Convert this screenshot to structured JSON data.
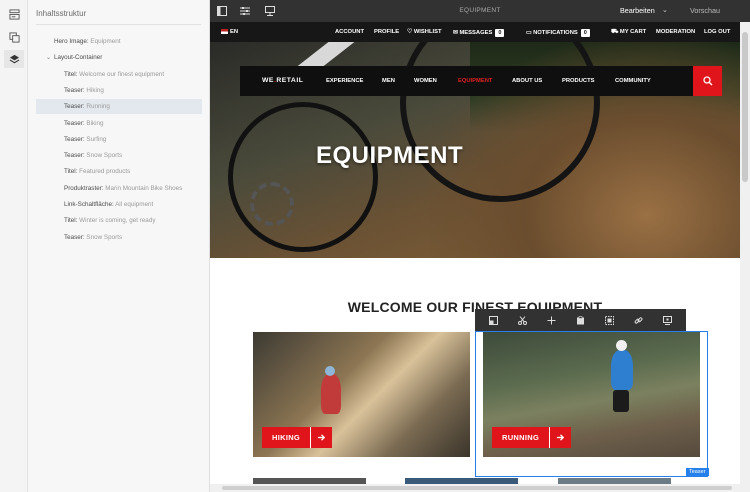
{
  "sidebar_rail": {
    "icons": [
      "components-icon",
      "assets-icon",
      "layers-icon"
    ]
  },
  "panel": {
    "title": "Inhaltsstruktur",
    "tree": [
      {
        "k": "Hero Image:",
        "v": "Equipment",
        "indent": 1
      },
      {
        "k": "Layout-Container",
        "v": "",
        "indent": 1,
        "toggle": "⌄"
      },
      {
        "k": "Titel:",
        "v": "Welcome our finest equipment",
        "indent": 2
      },
      {
        "k": "Teaser:",
        "v": "Hiking",
        "indent": 2
      },
      {
        "k": "Teaser:",
        "v": "Running",
        "indent": 2,
        "selected": true
      },
      {
        "k": "Teaser:",
        "v": "Biking",
        "indent": 2
      },
      {
        "k": "Teaser:",
        "v": "Surfing",
        "indent": 2
      },
      {
        "k": "Teaser:",
        "v": "Snow Sports",
        "indent": 2
      },
      {
        "k": "Titel:",
        "v": "Featured products",
        "indent": 2
      },
      {
        "k": "Produktraster:",
        "v": "Marin Mountain Bike Shoes",
        "indent": 2
      },
      {
        "k": "Link-Schaltfläche:",
        "v": "All equipment",
        "indent": 2
      },
      {
        "k": "Titel:",
        "v": "Winter is coming, get ready",
        "indent": 2
      },
      {
        "k": "Teaser:",
        "v": "Snow Sports",
        "indent": 2
      }
    ]
  },
  "topbar": {
    "title": "EQUIPMENT",
    "mode": "Bearbeiten",
    "mode_caret": "⌄",
    "preview": "Vorschau"
  },
  "utilbar": {
    "lang": "EN",
    "links": [
      "ACCOUNT",
      "PROFILE",
      "WISHLIST",
      "MESSAGES",
      "NOTIFICATIONS",
      "MY CART",
      "MODERATION",
      "LOG OUT"
    ],
    "messages_count": "0",
    "notifications_count": "0"
  },
  "nav": {
    "brand_a": "WE",
    "brand_dot": ".",
    "brand_b": "RETAIL",
    "items": [
      "EXPERIENCE",
      "MEN",
      "WOMEN",
      "EQUIPMENT",
      "ABOUT US",
      "PRODUCTS",
      "COMMUNITY"
    ],
    "active": "EQUIPMENT"
  },
  "hero": {
    "title": "EQUIPMENT"
  },
  "welcome": "WELCOME OUR FINEST EQUIPMENT",
  "teasers": [
    {
      "label": "HIKING"
    },
    {
      "label": "RUNNING"
    }
  ],
  "selection": {
    "tag": "Teaser"
  },
  "edit_toolbar": [
    "layout-icon",
    "cut-icon",
    "add-icon",
    "paste-icon",
    "group-icon",
    "link-icon",
    "configure-icon"
  ],
  "colors": {
    "accent": "#e0141b",
    "selection": "#2680eb",
    "dark": "#323232"
  }
}
